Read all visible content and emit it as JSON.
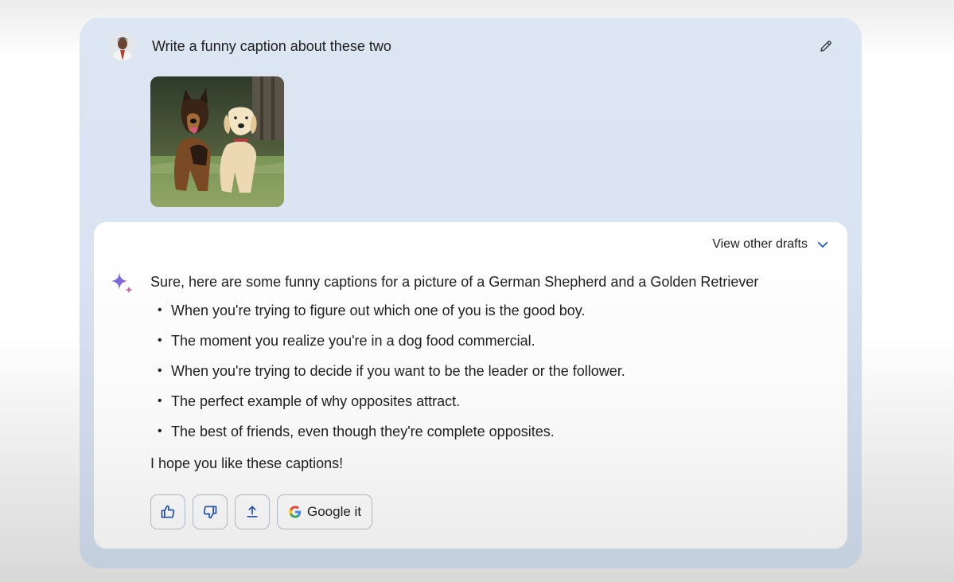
{
  "prompt": {
    "text": "Write a funny caption about these two",
    "avatar": "user-avatar",
    "edit_icon": "pencil-icon",
    "image_icon": "dog-photo"
  },
  "response": {
    "drafts_label": "View other drafts",
    "drafts_icon": "chevron-down-icon",
    "assistant_icon": "sparkle-icon",
    "intro": "Sure, here are some funny captions for a picture of a German Shepherd and a Golden Retriever",
    "captions": [
      "When you're trying to figure out which one of you is the good boy.",
      "The moment you realize you're in a dog food commercial.",
      "When you're trying to decide if you want to be the leader or the follower.",
      "The perfect example of why opposites attract.",
      "The best of friends, even though they're complete opposites."
    ],
    "outro": "I hope you like these captions!"
  },
  "actions": {
    "thumbs_up_icon": "thumbs-up-icon",
    "thumbs_down_icon": "thumbs-down-icon",
    "share_icon": "share-icon",
    "google_label": "Google it",
    "google_icon": "google-g-icon"
  },
  "colors": {
    "frame_bg": "#dce5f2",
    "card_bg": "#ffffff",
    "accent_blue": "#1a73e8",
    "text_primary": "#1f1f1f"
  }
}
